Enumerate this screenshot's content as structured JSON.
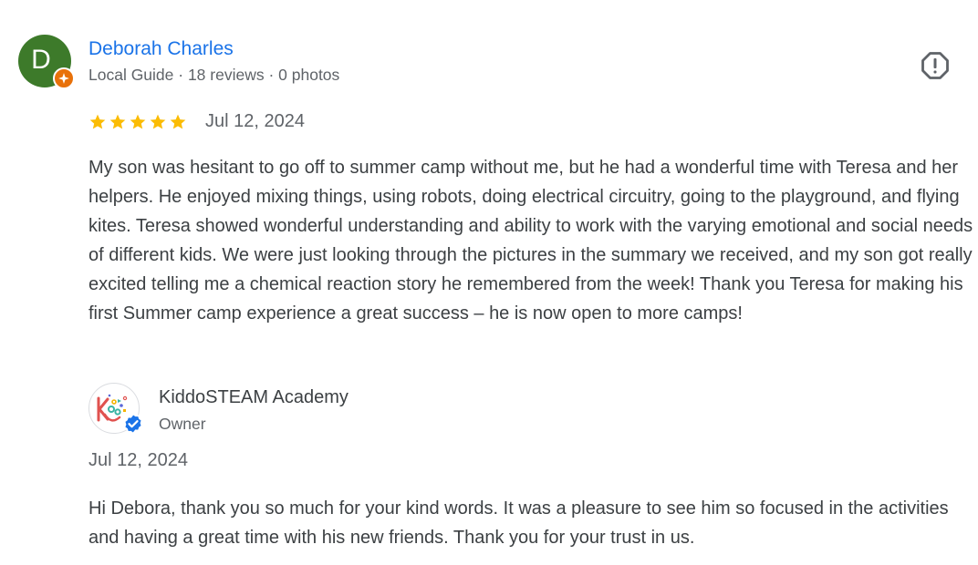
{
  "review": {
    "avatar_letter": "D",
    "avatar_color": "#3d7a2a",
    "badge_icon": "local-guide-badge-icon",
    "reviewer_name": "Deborah Charles",
    "reviewer_meta": "Local Guide · 18 reviews · 0 photos",
    "report_icon": "flag-report-icon",
    "rating": 5,
    "rating_max": 5,
    "date": "Jul 12, 2024",
    "text": "My son was hesitant to go off to summer camp without me, but he had a wonderful time with Teresa and her helpers. He enjoyed mixing things, using robots, doing electrical circuitry, going to the playground, and flying kites. Teresa showed wonderful understanding and ability to work with the varying emotional and social needs of different kids. We were just looking through the pictures in the summary we received, and my son got really excited telling me a chemical reaction story he remembered from the week! Thank you Teresa for making his first Summer camp experience a great success – he is now open to more camps!"
  },
  "owner_response": {
    "logo_icon": "kiddosteam-logo",
    "verified_icon": "verified-check-icon",
    "name": "KiddoSTEAM Academy",
    "role": "Owner",
    "date": "Jul 12, 2024",
    "text": "Hi Debora, thank you so much for your kind words. It was a pleasure to see him so focused in the activities and having a great time with his new friends. Thank you for your trust in us."
  },
  "colors": {
    "link_blue": "#1a73e8",
    "star_gold": "#fbbc04",
    "guide_orange": "#e8710a",
    "verified_blue": "#1a73e8",
    "muted_text": "#5f6368"
  }
}
